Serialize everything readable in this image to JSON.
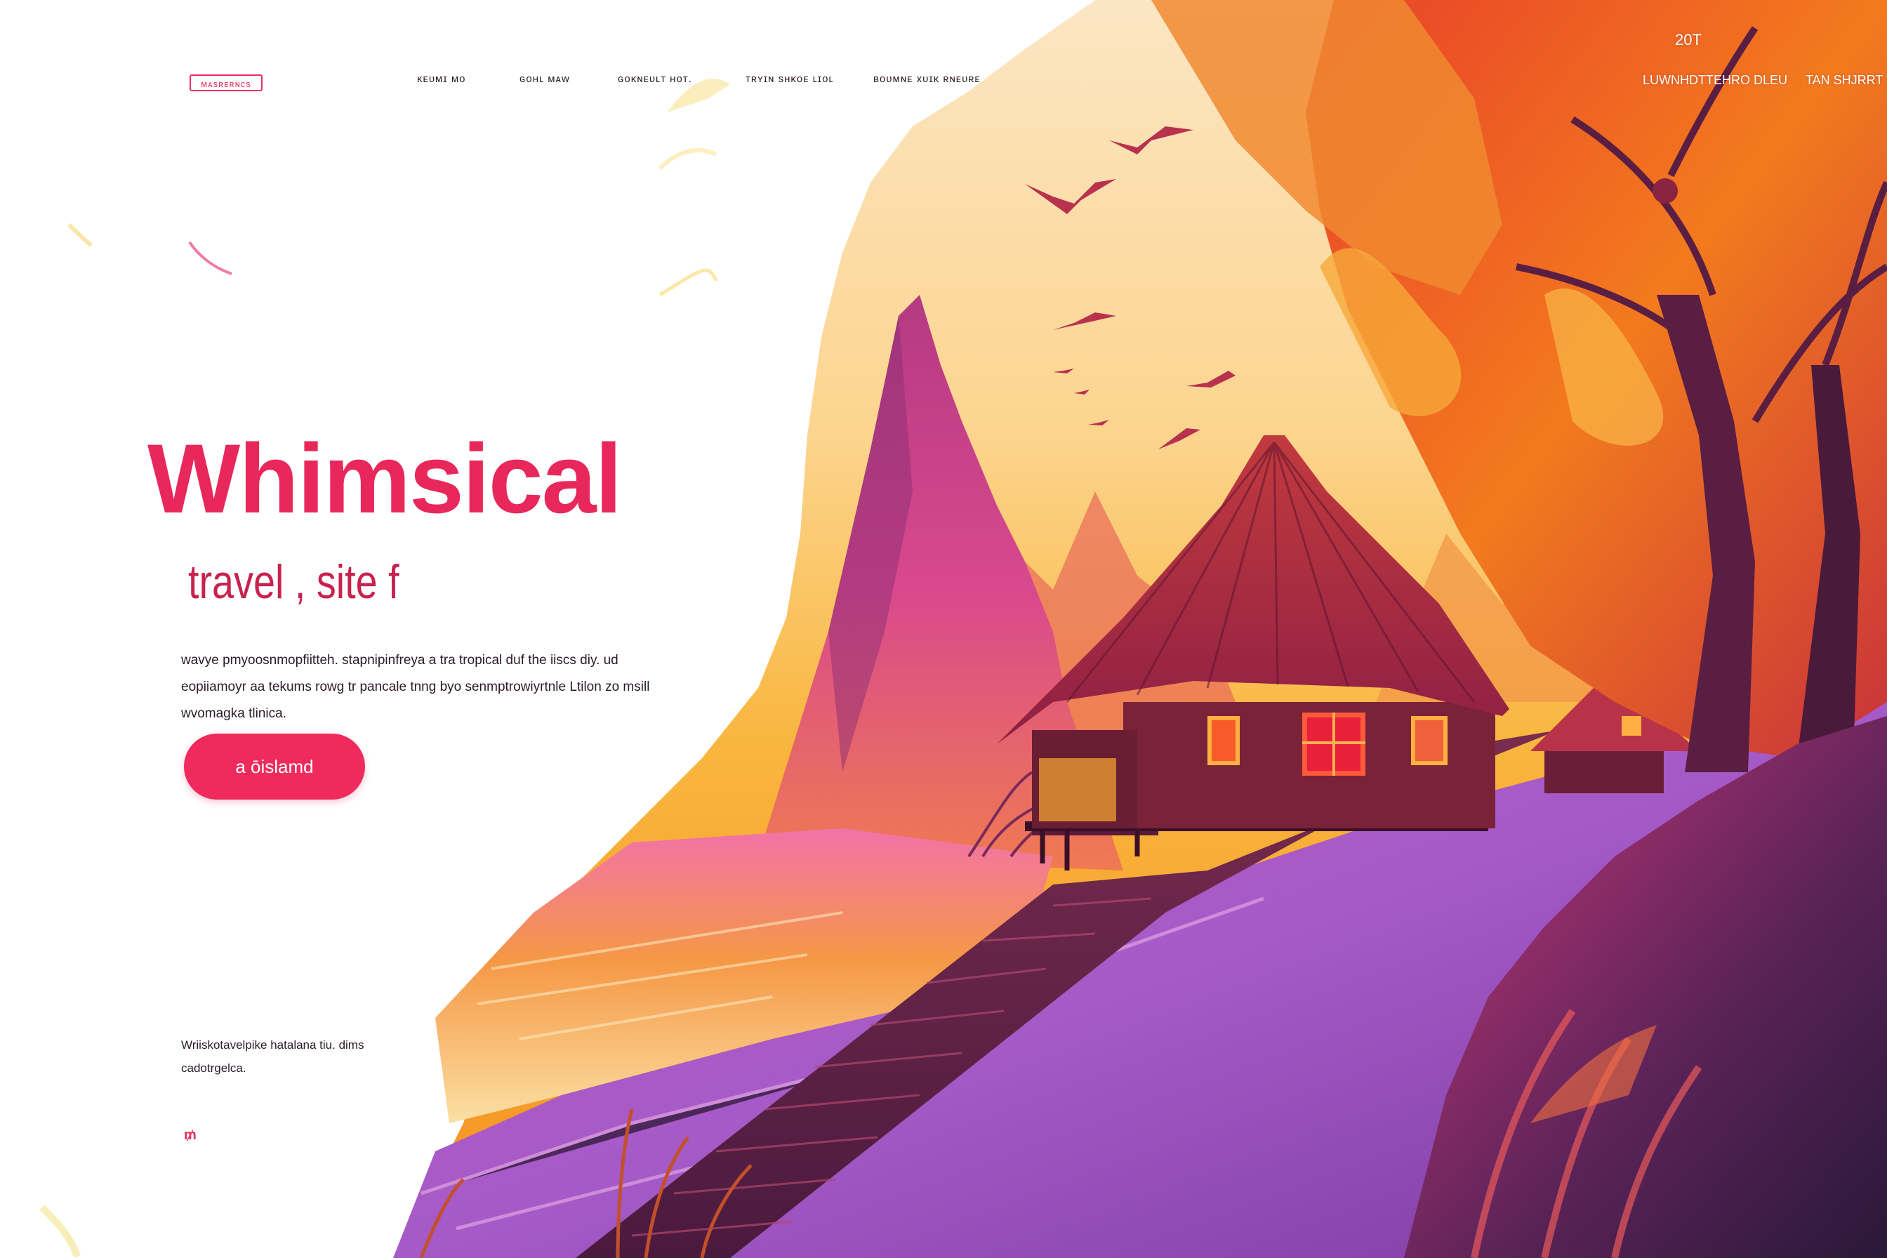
{
  "nav": {
    "logo": "ᴍᴀsʀᴇʀɴᴄs",
    "links": [
      {
        "label": "ᴋᴇᴜᴍɪ ᴍᴏ"
      },
      {
        "label": "ɢᴏʜʟ ᴍᴀᴡ"
      },
      {
        "label": "ɢᴏᴋɴᴇᴜʟᴛ ʜᴏᴛ."
      },
      {
        "label": "ᴛʀʏɪɴ sʜᴋᴏᴇ ʟɪᴏʟ"
      },
      {
        "label": "ʙᴏᴜᴍɴᴇ xᴜɪᴋ ʀɴᴇᴜʀᴇ"
      }
    ],
    "right_links": [
      {
        "label": "LUWNHDTTEHRO DLEU"
      },
      {
        "label": "TAN SHJRRT"
      }
    ],
    "counter": "20T"
  },
  "hero": {
    "title": "Whimsical",
    "subtitle": "travel , site f",
    "description": "wavye pmyoosnmopfiitteh. stapnipinfreya a tra tropical duf the iiscs diy. ud eopiiamoyr aa tekums rowg tr pancale tnng byo senmptrowiyrtnle Ltilon zo msill wvomagka tlinica.",
    "cta_label": "a ōislamd"
  },
  "footer": {
    "text": "Wriiskotavelpike hatalana tiu. dims cadotrgelca.",
    "icon": "m-logo-icon"
  },
  "colors": {
    "accent": "#ef2a5c",
    "title": "#e8285a",
    "text": "#2a1b28"
  }
}
